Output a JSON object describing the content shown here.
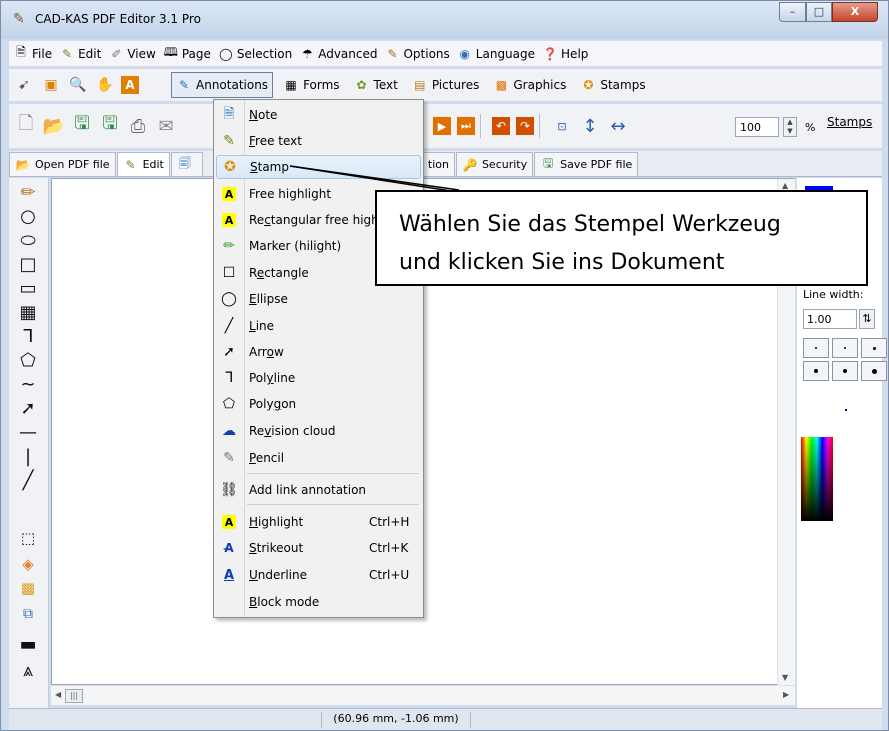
{
  "window": {
    "title": "CAD-KAS PDF Editor 3.1 Pro",
    "min_glyph": "–",
    "max_glyph": "□",
    "close_glyph": "X"
  },
  "menubar": {
    "items": [
      {
        "label": "File",
        "icon": "file-icon"
      },
      {
        "label": "Edit",
        "icon": "edit-icon"
      },
      {
        "label": "View",
        "icon": "view-icon"
      },
      {
        "label": "Page",
        "icon": "page-icon"
      },
      {
        "label": "Selection",
        "icon": "selection-icon"
      },
      {
        "label": "Advanced",
        "icon": "advanced-icon"
      },
      {
        "label": "Options",
        "icon": "options-icon"
      },
      {
        "label": "Language",
        "icon": "language-icon"
      },
      {
        "label": "Help",
        "icon": "help-icon"
      }
    ]
  },
  "toolbar1": {
    "tabs": [
      {
        "label": "Annotations",
        "icon": "annotations-icon"
      },
      {
        "label": "Forms",
        "icon": "forms-icon"
      },
      {
        "label": "Text",
        "icon": "text-icon"
      },
      {
        "label": "Pictures",
        "icon": "pictures-icon"
      },
      {
        "label": "Graphics",
        "icon": "graphics-icon"
      },
      {
        "label": "Stamps",
        "icon": "stamps-icon"
      }
    ]
  },
  "toolbar2": {
    "zoom_value": "100",
    "zoom_unit": "%",
    "stamps_label": "Stamps"
  },
  "doc_tabs": [
    {
      "label": "Open PDF file",
      "icon": "open-folder-icon"
    },
    {
      "label": "Edit",
      "icon": "edit-pen-icon"
    },
    {
      "label": "",
      "icon": "pages-icon"
    },
    {
      "label": "tion",
      "icon": ""
    },
    {
      "label": "Security",
      "icon": "key-icon"
    },
    {
      "label": "Save PDF file",
      "icon": "save-icon"
    }
  ],
  "annotations_menu": {
    "items": [
      {
        "label": "Note",
        "shortcut": ""
      },
      {
        "label": "Free text",
        "shortcut": ""
      },
      {
        "label": "Stamp",
        "shortcut": ""
      },
      {
        "label": "Free highlight",
        "shortcut": ""
      },
      {
        "label": "Rectangular free highlight",
        "shortcut": ""
      },
      {
        "label": "Marker (hilight)",
        "shortcut": ""
      },
      {
        "label": "Rectangle",
        "shortcut": ""
      },
      {
        "label": "Ellipse",
        "shortcut": ""
      },
      {
        "label": "Line",
        "shortcut": ""
      },
      {
        "label": "Arrow",
        "shortcut": ""
      },
      {
        "label": "Polyline",
        "shortcut": ""
      },
      {
        "label": "Polygon",
        "shortcut": ""
      },
      {
        "label": "Revision cloud",
        "shortcut": ""
      },
      {
        "label": "Pencil",
        "shortcut": ""
      },
      {
        "label": "Add link annotation",
        "shortcut": ""
      },
      {
        "label": "Highlight",
        "shortcut": "Ctrl+H"
      },
      {
        "label": "Strikeout",
        "shortcut": "Ctrl+K"
      },
      {
        "label": "Underline",
        "shortcut": "Ctrl+U"
      },
      {
        "label": "Block mode",
        "shortcut": ""
      }
    ]
  },
  "right_panel": {
    "line_width_label": "Line width:",
    "line_width_value": "1.00",
    "line_color": "#0000ff"
  },
  "callout": {
    "line1": "Wählen Sie das Stempel Werkzeug",
    "line2": "und klicken Sie ins Dokument"
  },
  "status": {
    "coordinates": "(60.96 mm, -1.06 mm)"
  }
}
